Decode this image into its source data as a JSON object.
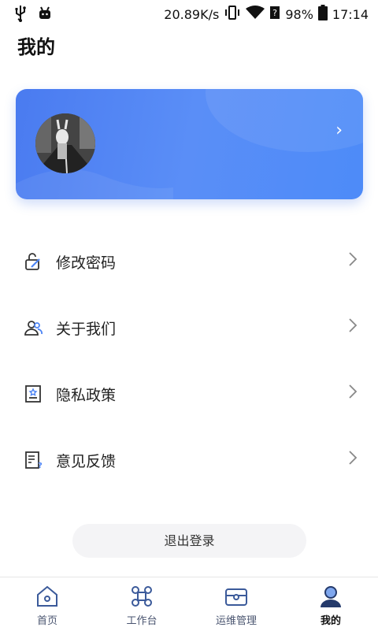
{
  "status_bar": {
    "network_speed": "20.89K/s",
    "battery": "98%",
    "time": "17:14"
  },
  "header": {
    "title": "我的"
  },
  "profile_card": {
    "arrow": "›"
  },
  "menu": {
    "items": [
      {
        "label": "修改密码",
        "icon": "edit-lock-icon"
      },
      {
        "label": "关于我们",
        "icon": "users-icon"
      },
      {
        "label": "隐私政策",
        "icon": "privacy-document-icon"
      },
      {
        "label": "意见反馈",
        "icon": "feedback-icon"
      }
    ]
  },
  "logout": {
    "label": "退出登录"
  },
  "tabbar": {
    "items": [
      {
        "label": "首页",
        "icon": "home-icon"
      },
      {
        "label": "工作台",
        "icon": "command-icon"
      },
      {
        "label": "运维管理",
        "icon": "toolbox-icon"
      },
      {
        "label": "我的",
        "icon": "user-icon",
        "active": true
      }
    ]
  },
  "colors": {
    "accent": "#4d84f4",
    "tab_active": "#3b5a9a"
  }
}
